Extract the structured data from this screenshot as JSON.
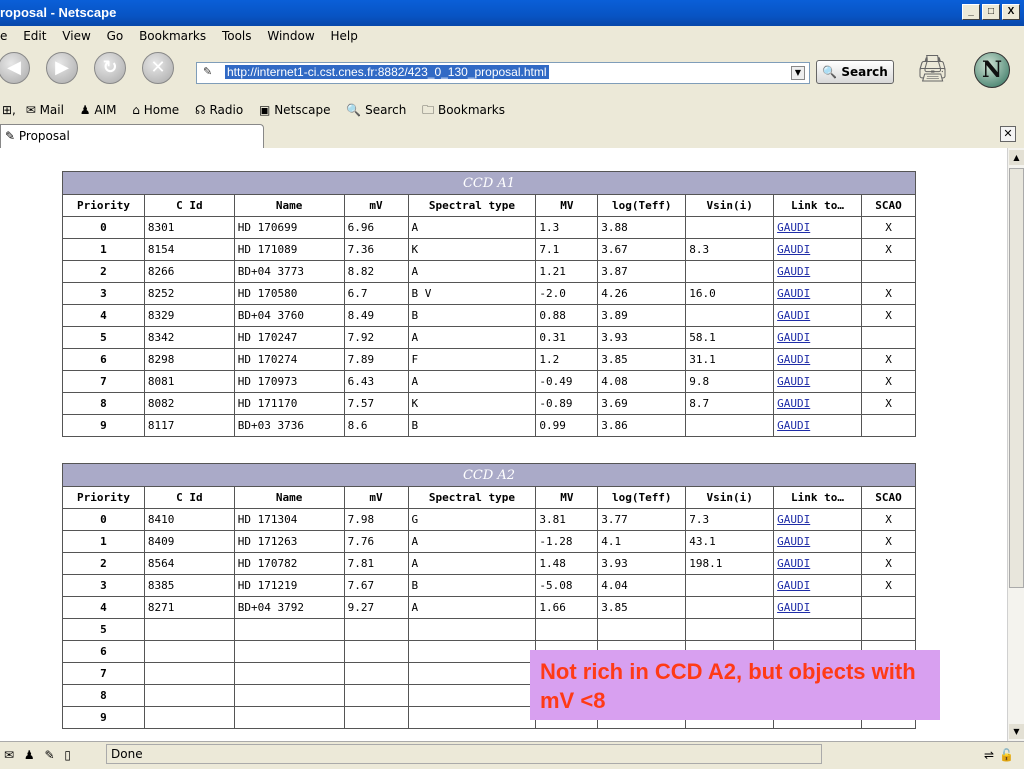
{
  "window": {
    "title": "roposal - Netscape",
    "controls": [
      "_",
      "□",
      "X"
    ]
  },
  "menubar": [
    "e",
    "Edit",
    "View",
    "Go",
    "Bookmarks",
    "Tools",
    "Window",
    "Help"
  ],
  "navbar": {
    "url": "http://internet1-ci.cst.cnes.fr:8882/423_0_130_proposal.html",
    "search_label": "Search"
  },
  "personalbar": [
    "Mail",
    "AIM",
    "Home",
    "Radio",
    "Netscape",
    "Search",
    "Bookmarks"
  ],
  "tab": {
    "label": "Proposal"
  },
  "tables": [
    {
      "caption": "CCD A1",
      "headers": [
        "Priority",
        "C Id",
        "Name",
        "mV",
        "Spectral type",
        "MV",
        "log(Teff)",
        "Vsin(i)",
        "Link to…",
        "SCAO"
      ],
      "rows": [
        [
          "0",
          "8301",
          "HD 170699",
          "6.96",
          "A",
          "1.3",
          "3.88",
          "",
          "GAUDI",
          "X"
        ],
        [
          "1",
          "8154",
          "HD 171089",
          "7.36",
          "K",
          "7.1",
          "3.67",
          "8.3",
          "GAUDI",
          "X"
        ],
        [
          "2",
          "8266",
          "BD+04 3773",
          "8.82",
          "A",
          "1.21",
          "3.87",
          "",
          "GAUDI",
          ""
        ],
        [
          "3",
          "8252",
          "HD 170580",
          "6.7",
          "B V",
          "-2.0",
          "4.26",
          "16.0",
          "GAUDI",
          "X"
        ],
        [
          "4",
          "8329",
          "BD+04 3760",
          "8.49",
          "B",
          "0.88",
          "3.89",
          "",
          "GAUDI",
          "X"
        ],
        [
          "5",
          "8342",
          "HD 170247",
          "7.92",
          "A",
          "0.31",
          "3.93",
          "58.1",
          "GAUDI",
          ""
        ],
        [
          "6",
          "8298",
          "HD 170274",
          "7.89",
          "F",
          "1.2",
          "3.85",
          "31.1",
          "GAUDI",
          "X"
        ],
        [
          "7",
          "8081",
          "HD 170973",
          "6.43",
          "A",
          "-0.49",
          "4.08",
          "9.8",
          "GAUDI",
          "X"
        ],
        [
          "8",
          "8082",
          "HD 171170",
          "7.57",
          "K",
          "-0.89",
          "3.69",
          "8.7",
          "GAUDI",
          "X"
        ],
        [
          "9",
          "8117",
          "BD+03 3736",
          "8.6",
          "B",
          "0.99",
          "3.86",
          "",
          "GAUDI",
          ""
        ]
      ]
    },
    {
      "caption": "CCD A2",
      "headers": [
        "Priority",
        "C Id",
        "Name",
        "mV",
        "Spectral type",
        "MV",
        "log(Teff)",
        "Vsin(i)",
        "Link to…",
        "SCAO"
      ],
      "rows": [
        [
          "0",
          "8410",
          "HD 171304",
          "7.98",
          "G",
          "3.81",
          "3.77",
          "7.3",
          "GAUDI",
          "X"
        ],
        [
          "1",
          "8409",
          "HD 171263",
          "7.76",
          "A",
          "-1.28",
          "4.1",
          "43.1",
          "GAUDI",
          "X"
        ],
        [
          "2",
          "8564",
          "HD 170782",
          "7.81",
          "A",
          "1.48",
          "3.93",
          "198.1",
          "GAUDI",
          "X"
        ],
        [
          "3",
          "8385",
          "HD 171219",
          "7.67",
          "B",
          "-5.08",
          "4.04",
          "",
          "GAUDI",
          "X"
        ],
        [
          "4",
          "8271",
          "BD+04 3792",
          "9.27",
          "A",
          "1.66",
          "3.85",
          "",
          "GAUDI",
          ""
        ],
        [
          "5",
          "",
          "",
          "",
          "",
          "",
          "",
          "",
          "",
          ""
        ],
        [
          "6",
          "",
          "",
          "",
          "",
          "",
          "",
          "",
          "",
          ""
        ],
        [
          "7",
          "",
          "",
          "",
          "",
          "",
          "",
          "",
          "",
          ""
        ],
        [
          "8",
          "",
          "",
          "",
          "",
          "",
          "",
          "",
          "",
          ""
        ],
        [
          "9",
          "",
          "",
          "",
          "",
          "",
          "",
          "",
          "",
          ""
        ]
      ]
    }
  ],
  "note": "Not rich in CCD A2, but objects with mV <8",
  "status": {
    "text": "Done"
  },
  "colors": {
    "caption_bg": "#aaaac8",
    "note_bg": "#d8a0f0",
    "note_text": "#ff3a16",
    "link": "#1f2da8"
  }
}
